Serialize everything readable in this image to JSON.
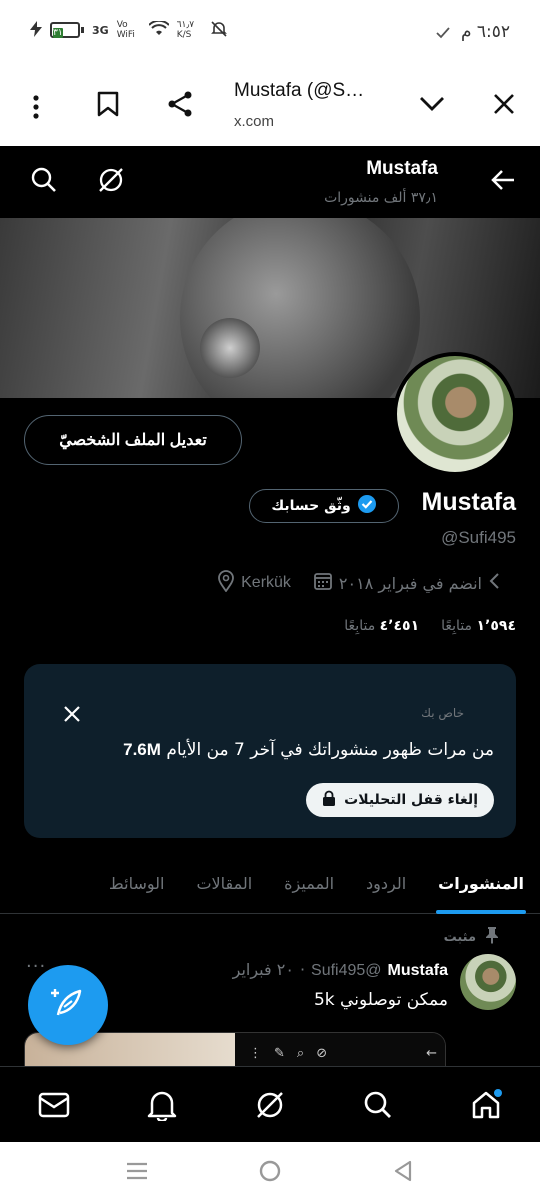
{
  "status_bar": {
    "time": "٦:٥٢ م",
    "battery": "٣١",
    "network": "3G",
    "volte": "Vo WiFi",
    "speed": "٦١٫٧ K/S"
  },
  "browser": {
    "title": "Mustafa (@S…",
    "url": "x.com"
  },
  "header": {
    "name": "Mustafa",
    "posts_count": "٣٧٫١ ألف منشورات"
  },
  "profile": {
    "edit_button": "تعديل الملف الشخصيّ",
    "name": "Mustafa",
    "verify_button": "وثّق حسابك",
    "handle": "@Sufi495",
    "location": "Kerkük",
    "joined": "انضم في فبراير ٢٠١٨",
    "following_count": "١٬٥٩٤",
    "following_label": "متابِعًا",
    "followers_count": "٤٬٤٥١",
    "followers_label": "متابِعًا"
  },
  "analytics": {
    "private_label": "خاص بك",
    "message_prefix": "من مرات ظهور منشوراتك في آخر 7 من الأيام",
    "message_value": "7.6M",
    "unlock_button": "إلغاء قفل التحليلات"
  },
  "tabs": [
    {
      "label": "المنشورات",
      "active": true
    },
    {
      "label": "الردود",
      "active": false
    },
    {
      "label": "المميزة",
      "active": false
    },
    {
      "label": "المقالات",
      "active": false
    },
    {
      "label": "الوسائط",
      "active": false
    }
  ],
  "tweet": {
    "pinned_label": "مثبت",
    "name": "Mustafa",
    "handle": "@Sufi495",
    "date": "٢٠ فبراير",
    "text": "ممكن توصلوني 5k"
  },
  "colors": {
    "accent": "#1d9bf0",
    "background": "#000000",
    "card": "#0e1f2b",
    "muted": "#71767b"
  }
}
